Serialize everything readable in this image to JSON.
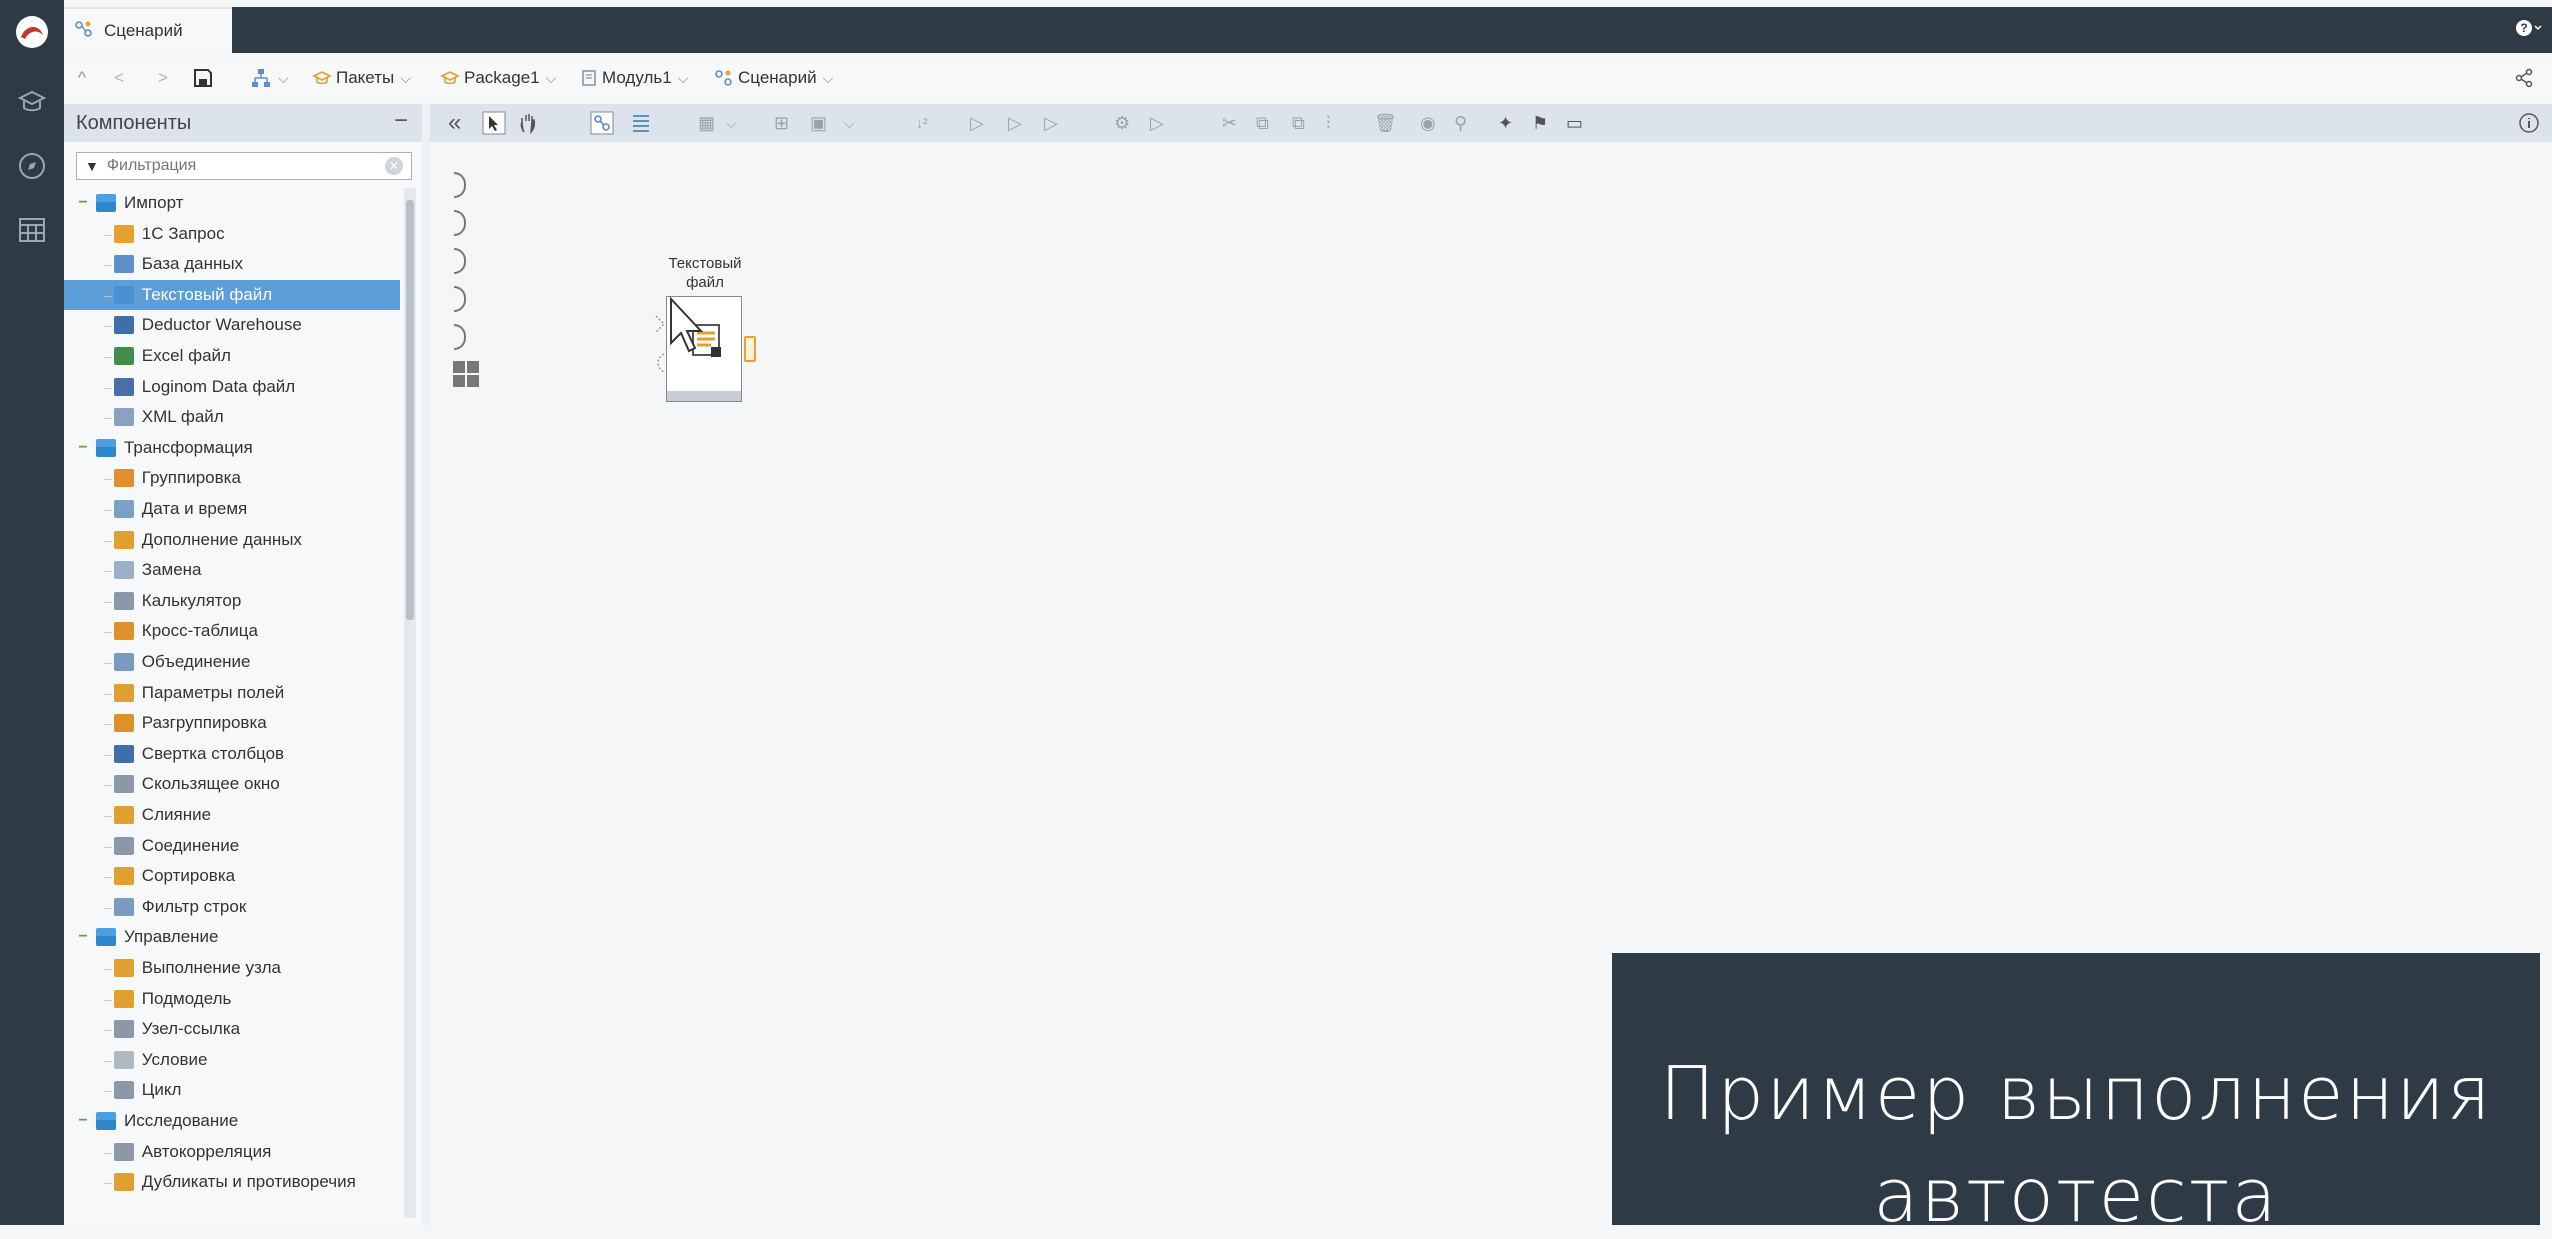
{
  "window": {
    "tab_title": "Сценарий",
    "help_label": "?"
  },
  "breadcrumb": {
    "nav": [
      "^",
      "<",
      ">"
    ],
    "items": [
      "Пакеты",
      "Package1",
      "Модуль1",
      "Сценарий"
    ],
    "share_label": "share"
  },
  "components": {
    "title": "Компоненты",
    "collapse": "−",
    "filter_placeholder": "Фильтрация",
    "tree": [
      {
        "label": "Импорт",
        "level": 0,
        "folder": true
      },
      {
        "label": "1С Запрос",
        "level": 1,
        "icon": "#e8a030"
      },
      {
        "label": "База данных",
        "level": 1,
        "icon": "#5c8fc8"
      },
      {
        "label": "Текстовый файл",
        "level": 1,
        "icon": "#4a90d0",
        "selected": true
      },
      {
        "label": "Deductor Warehouse",
        "level": 1,
        "icon": "#3f6fa8"
      },
      {
        "label": "Excel файл",
        "level": 1,
        "icon": "#3f8f4a"
      },
      {
        "label": "Loginom Data файл",
        "level": 1,
        "icon": "#4a6fa8"
      },
      {
        "label": "XML файл",
        "level": 1,
        "icon": "#8aa2c0"
      },
      {
        "label": "Трансформация",
        "level": 0,
        "folder": true
      },
      {
        "label": "Группировка",
        "level": 1,
        "icon": "#e0902a"
      },
      {
        "label": "Дата и время",
        "level": 1,
        "icon": "#7aa0c8"
      },
      {
        "label": "Дополнение данных",
        "level": 1,
        "icon": "#e0a030"
      },
      {
        "label": "Замена",
        "level": 1,
        "icon": "#9ab0c8"
      },
      {
        "label": "Калькулятор",
        "level": 1,
        "icon": "#8a98a8"
      },
      {
        "label": "Кросс-таблица",
        "level": 1,
        "icon": "#e0902a"
      },
      {
        "label": "Объединение",
        "level": 1,
        "icon": "#7a9ac0"
      },
      {
        "label": "Параметры полей",
        "level": 1,
        "icon": "#e0a030"
      },
      {
        "label": "Разгруппировка",
        "level": 1,
        "icon": "#e0902a"
      },
      {
        "label": "Свертка столбцов",
        "level": 1,
        "icon": "#3f6fa8"
      },
      {
        "label": "Скользящее окно",
        "level": 1,
        "icon": "#8a98a8"
      },
      {
        "label": "Слияние",
        "level": 1,
        "icon": "#e0a030"
      },
      {
        "label": "Соединение",
        "level": 1,
        "icon": "#8a98a8"
      },
      {
        "label": "Сортировка",
        "level": 1,
        "icon": "#e0a030"
      },
      {
        "label": "Фильтр строк",
        "level": 1,
        "icon": "#7a9ac0"
      },
      {
        "label": "Управление",
        "level": 0,
        "folder": true
      },
      {
        "label": "Выполнение узла",
        "level": 1,
        "icon": "#e0a030"
      },
      {
        "label": "Подмодель",
        "level": 1,
        "icon": "#e0a030"
      },
      {
        "label": "Узел-ссылка",
        "level": 1,
        "icon": "#8a98a8"
      },
      {
        "label": "Условие",
        "level": 1,
        "icon": "#b0b8c0"
      },
      {
        "label": "Цикл",
        "level": 1,
        "icon": "#8a98a8"
      },
      {
        "label": "Исследование",
        "level": 0,
        "folder": true
      },
      {
        "label": "Автокорреляция",
        "level": 1,
        "icon": "#8a98a8"
      },
      {
        "label": "Дубликаты и противоречия",
        "level": 1,
        "icon": "#e0a030"
      }
    ]
  },
  "toolbar": {
    "collapse": "«"
  },
  "canvas": {
    "node_label": [
      "Текстовый",
      "файл"
    ]
  },
  "caption": {
    "line1": "Пример выполнения",
    "line2": "автотеста"
  },
  "colors": {
    "dark": "#2f3a47",
    "selection": "#5c9fd8",
    "panel_header": "#dce3ea"
  }
}
